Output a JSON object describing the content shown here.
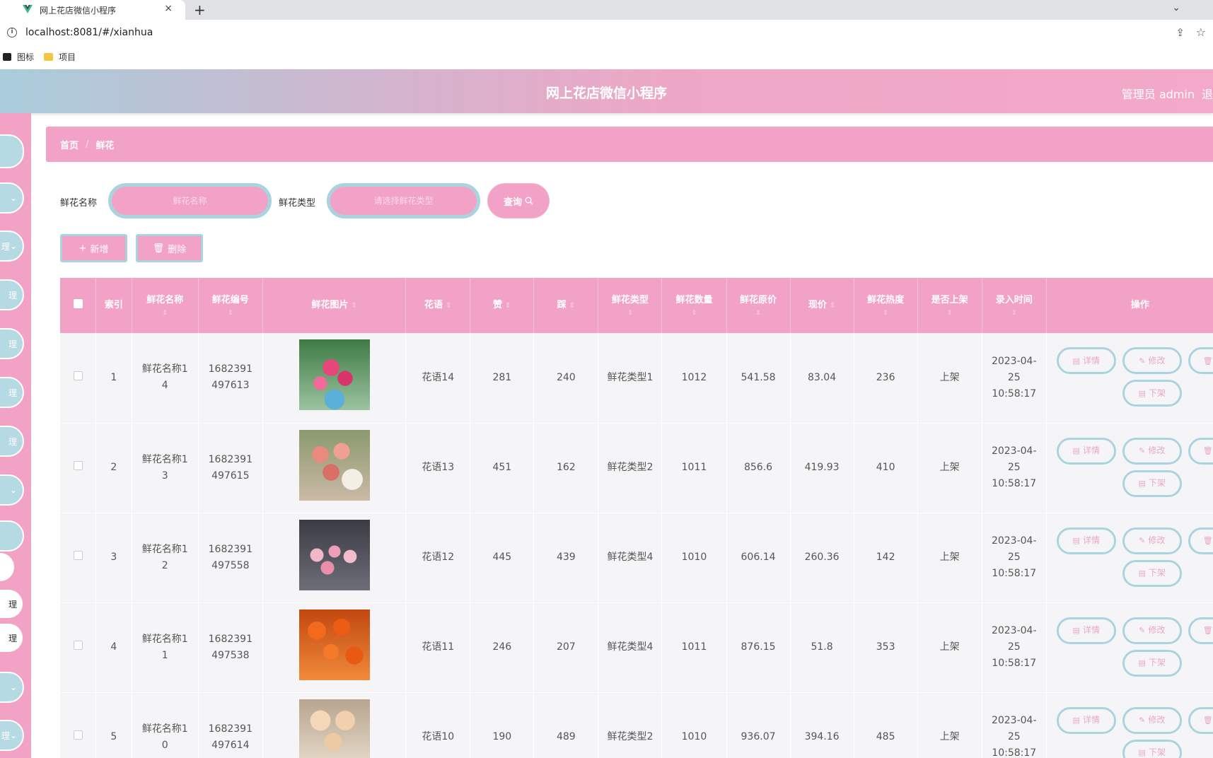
{
  "browser": {
    "tab_title": "网上花店微信小程序",
    "tab_close": "×",
    "new_tab": "+",
    "tabstrip_chevron": "⌄",
    "url": "localhost:8081/#/xianhua",
    "bookmarks": [
      {
        "label": "图标",
        "icon": "image-icon"
      },
      {
        "label": "项目",
        "icon": "folder-icon"
      }
    ]
  },
  "header": {
    "title": "网上花店微信小程序",
    "admin": "管理员 admin",
    "edge_text": "退"
  },
  "sidebar": {
    "items": [
      "",
      "",
      "理",
      "理",
      "理",
      "理",
      "理",
      "",
      "",
      "",
      "理",
      "理",
      "",
      "理"
    ]
  },
  "breadcrumb": {
    "home": "首页",
    "separator": "/",
    "current": "鲜花"
  },
  "search": {
    "name_label": "鲜花名称",
    "name_placeholder": "鲜花名称",
    "type_label": "鲜花类型",
    "type_placeholder": "请选择鲜花类型",
    "query_button": "查询"
  },
  "actions": {
    "add": "新增",
    "delete": "删除"
  },
  "table": {
    "columns": [
      "索引",
      "鲜花名称",
      "鲜花编号",
      "鲜花图片",
      "花语",
      "赞",
      "踩",
      "鲜花类型",
      "鲜花数量",
      "鲜花原价",
      "现价",
      "鲜花热度",
      "是否上架",
      "录入时间",
      "操作"
    ],
    "sort_icon": "⇕",
    "row_buttons": {
      "detail": "详情",
      "edit": "修改",
      "delete": "删除",
      "off_shelf": "下架"
    },
    "rows": [
      {
        "index": "1",
        "name": "鲜花名称14",
        "code": "1682391497613",
        "flower_language": "花语14",
        "likes": "281",
        "dislikes": "240",
        "type": "鲜花类型1",
        "quantity": "1012",
        "original_price": "541.58",
        "current_price": "83.04",
        "heat": "236",
        "on_shelf": "上架",
        "time": "2023-04-25 10:58:17",
        "image": "lily-bouquet"
      },
      {
        "index": "2",
        "name": "鲜花名称13",
        "code": "1682391497615",
        "flower_language": "花语13",
        "likes": "451",
        "dislikes": "162",
        "type": "鲜花类型2",
        "quantity": "1011",
        "original_price": "856.6",
        "current_price": "419.93",
        "heat": "410",
        "on_shelf": "上架",
        "time": "2023-04-25 10:58:17",
        "image": "carnation-bouquet"
      },
      {
        "index": "3",
        "name": "鲜花名称12",
        "code": "1682391497558",
        "flower_language": "花语12",
        "likes": "445",
        "dislikes": "439",
        "type": "鲜花类型4",
        "quantity": "1010",
        "original_price": "606.14",
        "current_price": "260.36",
        "heat": "142",
        "on_shelf": "上架",
        "time": "2023-04-25 10:58:17",
        "image": "pink-rose-bouquet"
      },
      {
        "index": "4",
        "name": "鲜花名称11",
        "code": "1682391497538",
        "flower_language": "花语11",
        "likes": "246",
        "dislikes": "207",
        "type": "鲜花类型4",
        "quantity": "1011",
        "original_price": "876.15",
        "current_price": "51.8",
        "heat": "353",
        "on_shelf": "上架",
        "time": "2023-04-25 10:58:17",
        "image": "orange-gerbera"
      },
      {
        "index": "5",
        "name": "鲜花名称10",
        "code": "1682391497614",
        "flower_language": "花语10",
        "likes": "190",
        "dislikes": "489",
        "type": "鲜花类型2",
        "quantity": "1010",
        "original_price": "936.07",
        "current_price": "394.16",
        "heat": "485",
        "on_shelf": "上架",
        "time": "2023-04-25 10:58:17",
        "image": "champagne-rose"
      }
    ]
  },
  "colors": {
    "primary_pink": "#f3a2c7",
    "accent_blue": "#a9d4df",
    "row_bg": "#f5f5f7"
  }
}
